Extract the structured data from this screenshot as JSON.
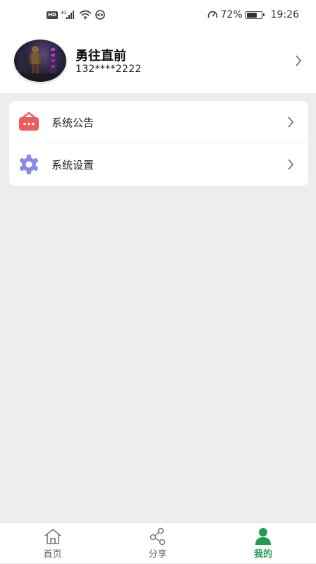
{
  "status_bar": {
    "hd_label": "HD",
    "network_label": "4G",
    "battery_percent": "72%",
    "battery_level": 0.72,
    "time": "19:26"
  },
  "profile": {
    "name": "勇往直前",
    "phone": "132****2222"
  },
  "menu": {
    "items": [
      {
        "label": "系统公告",
        "icon": "announcement-icon",
        "icon_color": "#ee5b5b"
      },
      {
        "label": "系统设置",
        "icon": "settings-gear-icon",
        "icon_color": "#8a8be6"
      }
    ]
  },
  "tabs": [
    {
      "label": "首页",
      "icon": "home-icon",
      "active": false
    },
    {
      "label": "分享",
      "icon": "share-icon",
      "active": false
    },
    {
      "label": "我的",
      "icon": "person-icon",
      "active": true
    }
  ],
  "colors": {
    "accent": "#1f9d55",
    "page_background": "#ededed",
    "inactive_tab": "#666666"
  }
}
